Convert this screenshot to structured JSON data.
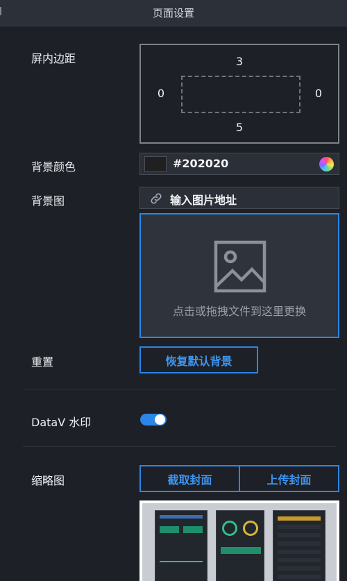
{
  "header": {
    "title": "页面设置"
  },
  "padding": {
    "label": "屏内边距",
    "top": "3",
    "left": "0",
    "right": "0",
    "bottom": "5"
  },
  "background_color": {
    "label": "背景颜色",
    "value": "#202020",
    "swatch": "#202020"
  },
  "background_image": {
    "label": "背景图",
    "url_placeholder": "输入图片地址",
    "upload_hint": "点击或拖拽文件到这里更换"
  },
  "reset": {
    "label": "重置",
    "button": "恢复默认背景"
  },
  "watermark": {
    "label": "DataV 水印",
    "enabled": true
  },
  "thumbnail": {
    "label": "缩略图",
    "capture_button": "截取封面",
    "upload_button": "上传封面"
  },
  "colors": {
    "accent": "#2a86e8",
    "panel": "#1d2027",
    "header": "#2c3038"
  }
}
